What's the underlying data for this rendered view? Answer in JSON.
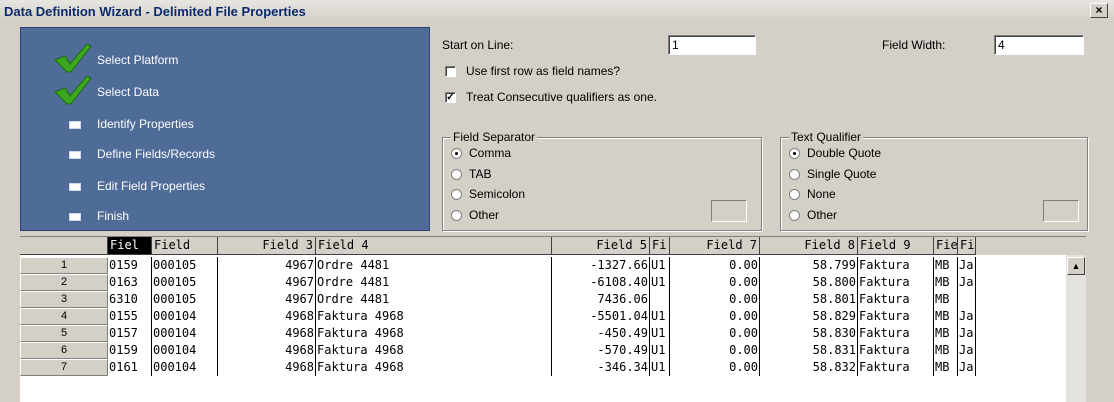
{
  "window": {
    "title": "Data Definition Wizard - Delimited File Properties",
    "close_label": "×"
  },
  "steps": [
    {
      "label": "Select Platform",
      "status": "done"
    },
    {
      "label": "Select Data",
      "status": "done"
    },
    {
      "label": "Identify Properties",
      "status": "pending"
    },
    {
      "label": "Define Fields/Records",
      "status": "pending"
    },
    {
      "label": "Edit Field Properties",
      "status": "pending"
    },
    {
      "label": "Finish",
      "status": "pending"
    }
  ],
  "form": {
    "start_on_line_label": "Start on Line:",
    "start_on_line_value": "1",
    "field_width_label": "Field Width:",
    "field_width_value": "4",
    "use_first_row_label": "Use first row as field names?",
    "use_first_row_checked": false,
    "treat_consecutive_label": "Treat Consecutive qualifiers as one.",
    "treat_consecutive_checked": true
  },
  "field_separator": {
    "title": "Field Separator",
    "options": [
      "Comma",
      "TAB",
      "Semicolon",
      "Other"
    ],
    "selected": "Comma"
  },
  "text_qualifier": {
    "title": "Text Qualifier",
    "options": [
      "Double Quote",
      "Single Quote",
      "None",
      "Other"
    ],
    "selected": "Double Quote"
  },
  "grid": {
    "headers": [
      "Fiel",
      "Field",
      "Field 3",
      "Field 4",
      "Field 5",
      "Fi",
      "Field 7",
      "Field 8",
      "Field 9",
      "Fie",
      "Fi"
    ],
    "rows": [
      {
        "num": "1",
        "cells": [
          "0159",
          "000105",
          "4967",
          "Ordre 4481",
          "-1327.66",
          "U1",
          "0.00",
          "58.799",
          "Faktura",
          "MB",
          "Ja"
        ]
      },
      {
        "num": "2",
        "cells": [
          "0163",
          "000105",
          "4967",
          "Ordre 4481",
          "-6108.40",
          "U1",
          "0.00",
          "58.800",
          "Faktura",
          "MB",
          "Ja"
        ]
      },
      {
        "num": "3",
        "cells": [
          "6310",
          "000105",
          "4967",
          "Ordre 4481",
          "7436.06",
          "",
          "0.00",
          "58.801",
          "Faktura",
          "MB",
          ""
        ]
      },
      {
        "num": "4",
        "cells": [
          "0155",
          "000104",
          "4968",
          "Faktura 4968",
          "-5501.04",
          "U1",
          "0.00",
          "58.829",
          "Faktura",
          "MB",
          "Ja"
        ]
      },
      {
        "num": "5",
        "cells": [
          "0157",
          "000104",
          "4968",
          "Faktura 4968",
          "-450.49",
          "U1",
          "0.00",
          "58.830",
          "Faktura",
          "MB",
          "Ja"
        ]
      },
      {
        "num": "6",
        "cells": [
          "0159",
          "000104",
          "4968",
          "Faktura 4968",
          "-570.49",
          "U1",
          "0.00",
          "58.831",
          "Faktura",
          "MB",
          "Ja"
        ]
      },
      {
        "num": "7",
        "cells": [
          "0161",
          "000104",
          "4968",
          "Faktura 4968",
          "-346.34",
          "U1",
          "0.00",
          "58.832",
          "Faktura",
          "MB",
          "Ja"
        ]
      }
    ]
  }
}
